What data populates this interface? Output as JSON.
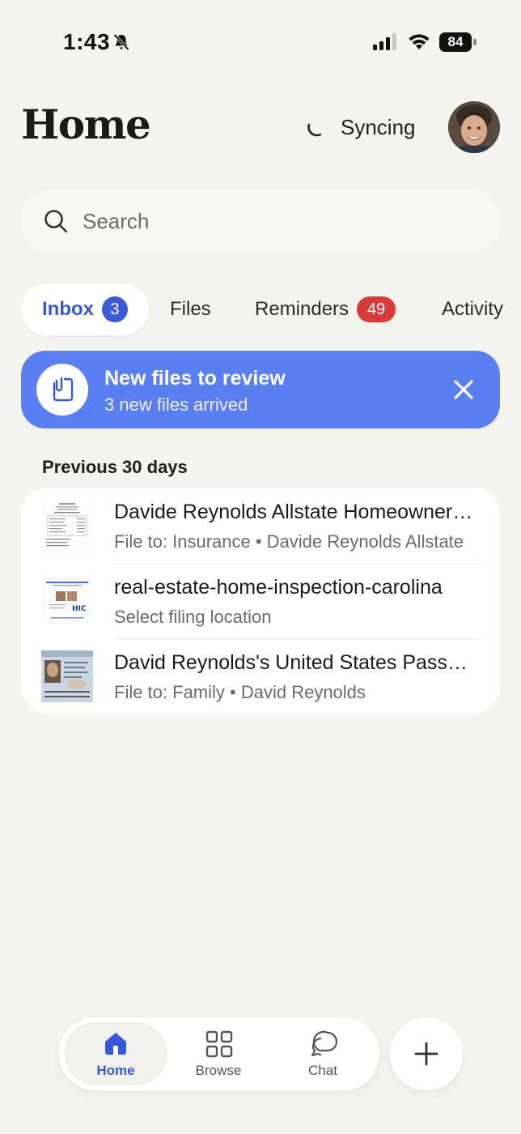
{
  "status_bar": {
    "time": "1:43",
    "battery": "84"
  },
  "header": {
    "title": "Home",
    "sync_label": "Syncing"
  },
  "search": {
    "placeholder": "Search"
  },
  "tabs": [
    {
      "label": "Inbox",
      "badge": "3",
      "active": true
    },
    {
      "label": "Files"
    },
    {
      "label": "Reminders",
      "badge": "49"
    },
    {
      "label": "Activity"
    }
  ],
  "banner": {
    "title": "New files to review",
    "subtitle": "3 new files arrived"
  },
  "section": {
    "title": "Previous 30 days"
  },
  "files": [
    {
      "name": "Davide Reynolds Allstate Homeowners Insurance",
      "sub": "File to: Insurance • Davide Reynolds Allstate"
    },
    {
      "name": "real-estate-home-inspection-carolina",
      "sub": "Select filing location"
    },
    {
      "name": "David Reynolds's United States Passport",
      "sub": "File to: Family • David Reynolds"
    }
  ],
  "bottom_nav": {
    "items": [
      {
        "label": "Home",
        "icon": "home-icon",
        "active": true
      },
      {
        "label": "Browse",
        "icon": "grid-icon"
      },
      {
        "label": "Chat",
        "icon": "chat-icon"
      }
    ],
    "add_icon": "plus-icon"
  },
  "colors": {
    "background": "#f4f3ee",
    "accent": "#3558d6",
    "banner": "#5a7ff3",
    "badge_red": "#d93b3b"
  }
}
